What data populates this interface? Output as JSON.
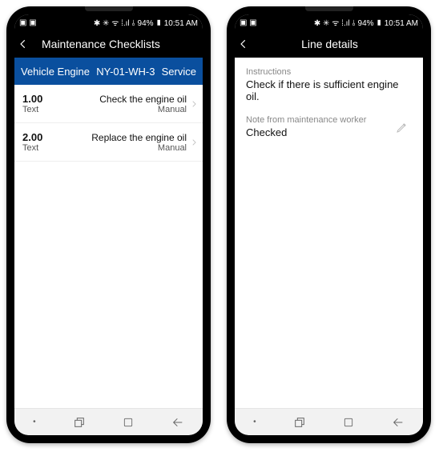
{
  "status": {
    "left_icons": "▣ ▣",
    "right_text": "✱ ✳ ᯤ ⁞.ıl ⫰ 94% ▮ 10:51 AM"
  },
  "left_phone": {
    "header": {
      "title": "Maintenance Checklists"
    },
    "subheader": {
      "col1": "Vehicle Engine",
      "col2": "NY-01-WH-3",
      "col3": "Service"
    },
    "rows": [
      {
        "num": "1.00",
        "type": "Text",
        "desc": "Check the engine oil",
        "mode": "Manual"
      },
      {
        "num": "2.00",
        "type": "Text",
        "desc": "Replace the engine oil",
        "mode": "Manual"
      }
    ]
  },
  "right_phone": {
    "header": {
      "title": "Line details"
    },
    "instructions": {
      "label": "Instructions",
      "text": "Check if there is sufficient engine oil."
    },
    "note": {
      "label": "Note from maintenance worker",
      "text": "Checked"
    }
  },
  "nav": {
    "dot": "•",
    "recent": "⟓",
    "home": "▢",
    "back": "←"
  }
}
